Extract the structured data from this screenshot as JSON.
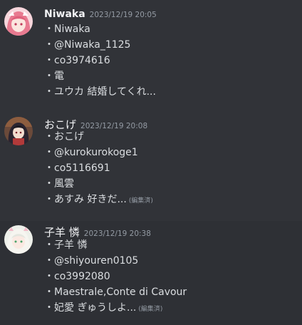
{
  "messages": [
    {
      "username": "Niwaka",
      "timestamp": "2023/12/19 20:05",
      "avatar_icon": "pink-hair-character-avatar",
      "lines": [
        "・Niwaka",
        "・@Niwaka_1125",
        "・co3974616",
        "・電",
        "・ユウカ 結婚してくれ..."
      ],
      "edited_label": ""
    },
    {
      "username": "おこげ",
      "timestamp": "2023/12/19 20:08",
      "avatar_icon": "dark-hair-character-avatar",
      "lines": [
        "・おこげ",
        "・@kurokurokoge1",
        "・co5116691",
        "・風雲",
        "・あすみ 好きだ..."
      ],
      "edited_label": "(編集済)"
    },
    {
      "username": "子羊 憐",
      "timestamp": "2023/12/19 20:38",
      "avatar_icon": "white-hair-character-avatar",
      "lines": [
        "・子羊 憐",
        "・@shiyouren0105",
        "・co3992080",
        "・Maestrale,Conte di Cavour",
        "・妃愛 ぎゅうしよ..."
      ],
      "edited_label": "(編集済)"
    }
  ],
  "colors": {
    "background": "#313338",
    "highlight_background": "#2e3035",
    "username": "#f2f3f5",
    "text": "#dbdee1",
    "muted": "#949ba4"
  }
}
